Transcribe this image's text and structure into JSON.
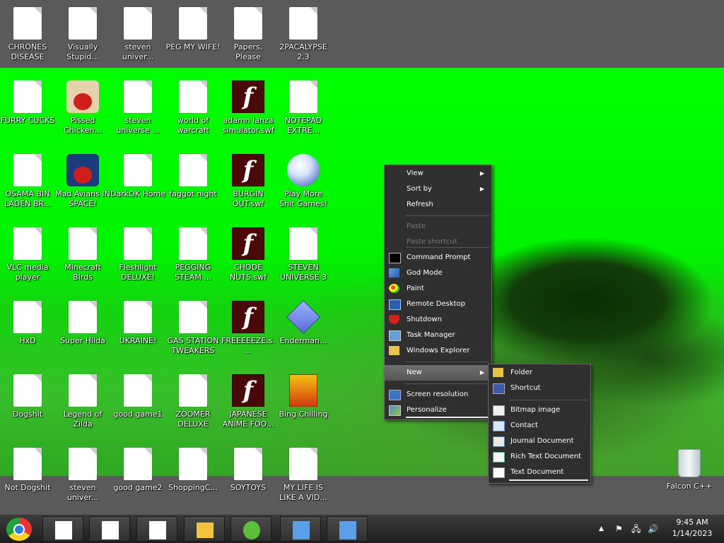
{
  "desktop": {
    "icons": [
      {
        "label": "CHRONES DISEASE",
        "type": "doc"
      },
      {
        "label": "Visually Stupid...",
        "type": "doc"
      },
      {
        "label": "steven univer...",
        "type": "doc"
      },
      {
        "label": "PEG MY WIFE!",
        "type": "doc"
      },
      {
        "label": "Papers, Please",
        "type": "doc"
      },
      {
        "label": "2PACALYPSE 2.3",
        "type": "doc"
      },
      {
        "label": "FURRY CUCKS",
        "type": "doc"
      },
      {
        "label": "Pissed Chicken...",
        "type": "angrybirds"
      },
      {
        "label": "steven universe ...",
        "type": "doc"
      },
      {
        "label": "world of warcraft",
        "type": "doc"
      },
      {
        "label": "adamn lanza simulator.swf",
        "type": "flash"
      },
      {
        "label": "NOTEPAD EXTRE...",
        "type": "doc"
      },
      {
        "label": "OSAMA BIN LADEN BR...",
        "type": "doc"
      },
      {
        "label": "Mad Avians IN SPACE!",
        "type": "angrybirds-space"
      },
      {
        "label": "DarkOK Home",
        "type": "doc"
      },
      {
        "label": "faggot night",
        "type": "doc"
      },
      {
        "label": "BURGIN OUT.swf",
        "type": "flash"
      },
      {
        "label": "Play More Shit Games!",
        "type": "popcap"
      },
      {
        "label": "VLC media player",
        "type": "doc"
      },
      {
        "label": "Minecraft Birds",
        "type": "doc"
      },
      {
        "label": "Fleshlight DELUXE!",
        "type": "doc"
      },
      {
        "label": "PEGGING STEAM ...",
        "type": "doc"
      },
      {
        "label": "CHODE NUTS.swf",
        "type": "flash"
      },
      {
        "label": "STEVEN UNIVERSE 3",
        "type": "doc"
      },
      {
        "label": "HxD",
        "type": "doc"
      },
      {
        "label": "Super Hilda",
        "type": "doc"
      },
      {
        "label": "UKRAINE!",
        "type": "doc"
      },
      {
        "label": "GAS STATION TWEAKERS",
        "type": "doc"
      },
      {
        "label": "FREEEEEZE.s...",
        "type": "flash"
      },
      {
        "label": "Enderman...",
        "type": "diamond"
      },
      {
        "label": "Dogshit",
        "type": "doc"
      },
      {
        "label": "Legend of Zilda",
        "type": "doc"
      },
      {
        "label": "good game1",
        "type": "doc"
      },
      {
        "label": "ZOOMER DELUXE",
        "type": "doc"
      },
      {
        "label": "JAPANESE ANIME FOO...",
        "type": "flash"
      },
      {
        "label": "Bing Chilling",
        "type": "bing"
      },
      {
        "label": "Not Dogshit",
        "type": "doc"
      },
      {
        "label": "steven univer...",
        "type": "doc"
      },
      {
        "label": "good game2",
        "type": "doc"
      },
      {
        "label": "ShoppingC...",
        "type": "doc"
      },
      {
        "label": "SOYTOYS",
        "type": "doc"
      },
      {
        "label": "MY LIFE IS LIKE A VID...",
        "type": "doc"
      }
    ],
    "recycle_bin": {
      "label": "Falcon C++",
      "icon": "recycle-bin-icon"
    }
  },
  "context_menu": {
    "items": [
      {
        "label": "View",
        "submenu": true,
        "disabled": false,
        "icon": ""
      },
      {
        "label": "Sort by",
        "submenu": true,
        "disabled": false,
        "icon": ""
      },
      {
        "label": "Refresh",
        "submenu": false,
        "disabled": false,
        "icon": ""
      },
      {
        "label": "Paste",
        "submenu": false,
        "disabled": true,
        "icon": ""
      },
      {
        "label": "Paste shortcut",
        "submenu": false,
        "disabled": true,
        "icon": ""
      },
      {
        "label": "Command Prompt",
        "submenu": false,
        "disabled": false,
        "icon": "command-prompt-icon"
      },
      {
        "label": "God Mode",
        "submenu": false,
        "disabled": false,
        "icon": "control-panel-icon"
      },
      {
        "label": "Paint",
        "submenu": false,
        "disabled": false,
        "icon": "paint-palette-icon"
      },
      {
        "label": "Remote Desktop",
        "submenu": false,
        "disabled": false,
        "icon": "remote-desktop-icon"
      },
      {
        "label": "Shutdown",
        "submenu": false,
        "disabled": false,
        "icon": "shutdown-shield-icon"
      },
      {
        "label": "Task Manager",
        "submenu": false,
        "disabled": false,
        "icon": "task-manager-icon"
      },
      {
        "label": "Windows Explorer",
        "submenu": false,
        "disabled": false,
        "icon": "folder-icon"
      },
      {
        "label": "New",
        "submenu": true,
        "disabled": false,
        "highlighted": true,
        "icon": ""
      },
      {
        "label": "Screen resolution",
        "submenu": false,
        "disabled": false,
        "icon": "monitor-icon"
      },
      {
        "label": "Personalize",
        "submenu": false,
        "disabled": false,
        "icon": "personalize-icon"
      }
    ]
  },
  "new_submenu": {
    "items": [
      {
        "label": "Folder",
        "icon": "folder-icon"
      },
      {
        "label": "Shortcut",
        "icon": "shortcut-icon"
      },
      {
        "label": "Bitmap image",
        "icon": "bitmap-icon"
      },
      {
        "label": "Contact",
        "icon": "contact-icon"
      },
      {
        "label": "Journal Document",
        "icon": "journal-icon"
      },
      {
        "label": "Rich Text Document",
        "icon": "rich-text-icon"
      },
      {
        "label": "Text Document",
        "icon": "text-document-icon"
      }
    ]
  },
  "taskbar": {
    "start_icon": "chrome-start-icon",
    "clock": {
      "time": "9:45 AM",
      "date": "1/14/2023"
    },
    "tray": {
      "chevron": "▲",
      "flag": "⚑",
      "network": "🖧",
      "volume": "🔊"
    }
  },
  "colors": {
    "wallpaper_green": "#00ff00",
    "menu_bg": "#2f2f2f",
    "band_gray": "#5a5a5a"
  }
}
